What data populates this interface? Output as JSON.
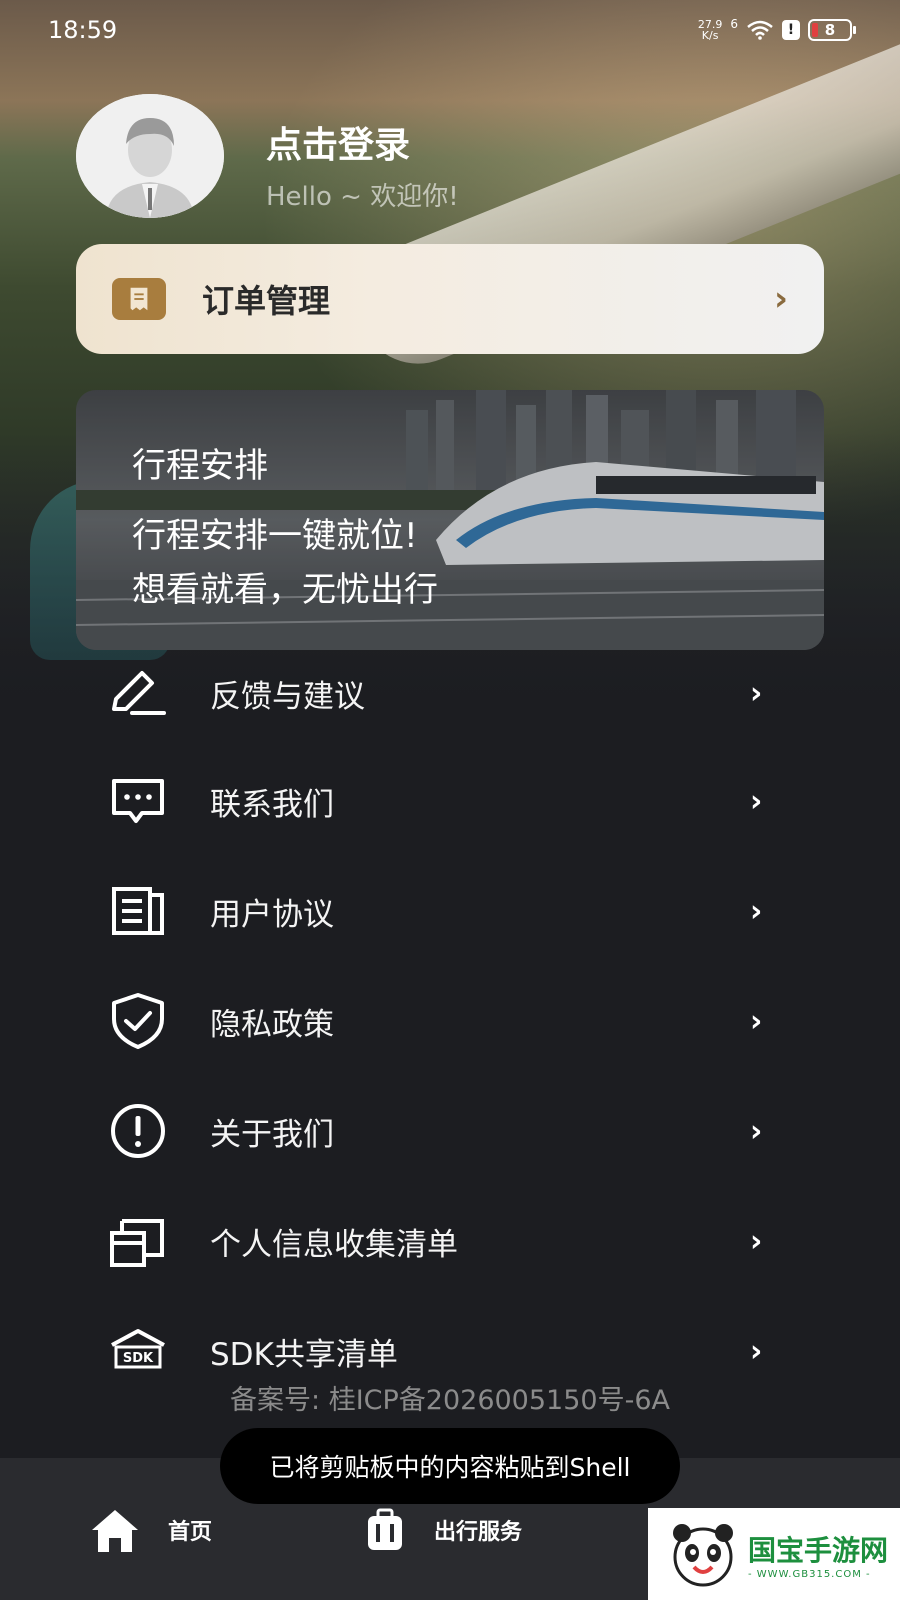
{
  "status_bar": {
    "time": "18:59",
    "net_speed_value": "27.9",
    "net_speed_unit": "K/s",
    "net_signal": "6",
    "alert": "!",
    "battery": "8"
  },
  "profile": {
    "title": "点击登录",
    "subtitle": "Hello ~ 欢迎你!"
  },
  "order": {
    "label": "订单管理",
    "chevron": "›"
  },
  "trip_banner": {
    "title": "行程安排",
    "line1": "行程安排一键就位!",
    "line2": "想看就看，无忧出行"
  },
  "menu": {
    "items": [
      {
        "label": "反馈与建议",
        "icon": "feedback-pencil-icon"
      },
      {
        "label": "联系我们",
        "icon": "message-icon"
      },
      {
        "label": "用户协议",
        "icon": "document-icon"
      },
      {
        "label": "隐私政策",
        "icon": "shield-check-icon"
      },
      {
        "label": "关于我们",
        "icon": "info-circle-icon"
      },
      {
        "label": "个人信息收集清单",
        "icon": "folder-card-icon"
      },
      {
        "label": "SDK共享清单",
        "icon": "sdk-box-icon"
      }
    ],
    "chevron": "›"
  },
  "icp": "备案号: 桂ICP备2026005150号-6A",
  "toast": "已将剪贴板中的内容粘贴到Shell",
  "bottom_nav": {
    "home": "首页",
    "travel": "出行服务"
  },
  "watermark": {
    "brand": "国宝手游网",
    "url": "- WWW.GB315.COM -"
  },
  "colors": {
    "background": "#1c1d21",
    "order_accent": "#a87d3e",
    "watermark_green": "#1d8f3e"
  }
}
